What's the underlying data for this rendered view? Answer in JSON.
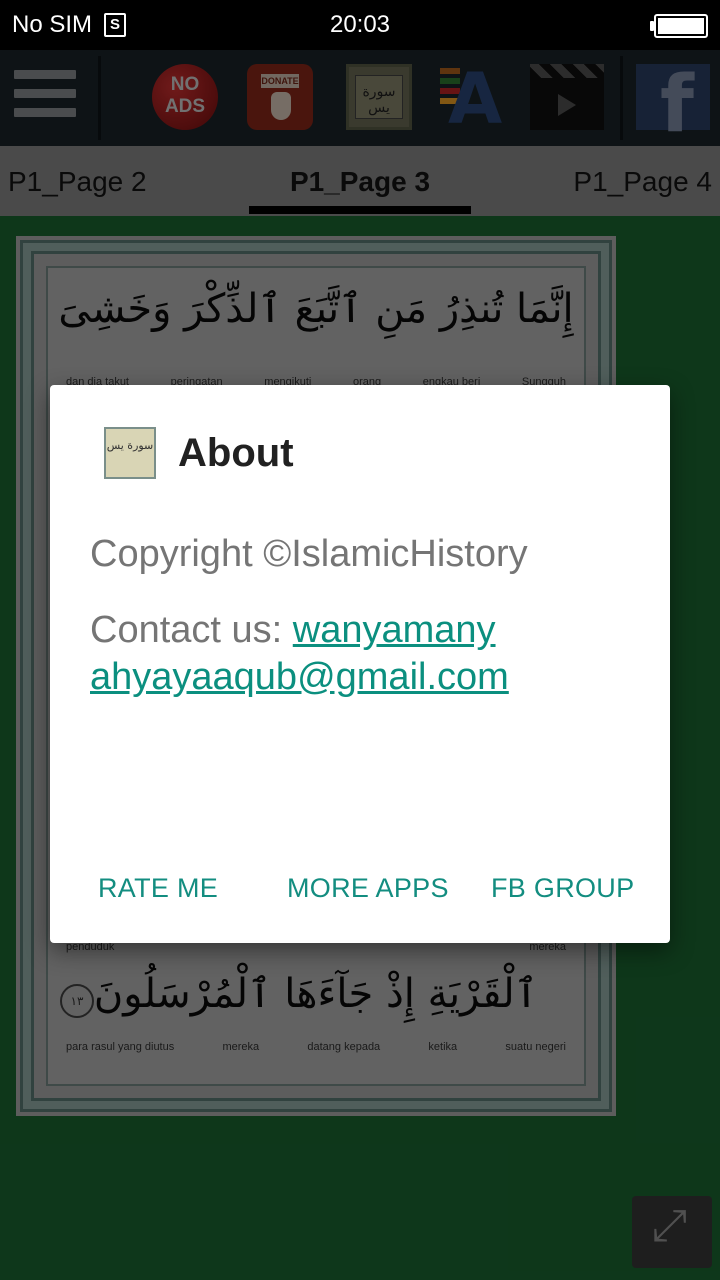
{
  "status_bar": {
    "carrier": "No SIM",
    "sim_icon_letter": "S",
    "time": "20:03"
  },
  "toolbar": {
    "menu_icon": "hamburger-icon",
    "noads_label": "NO ADS",
    "donate_label": "DONATE",
    "icons": [
      "no-ads-icon",
      "donate-icon",
      "surah-yasin-icon",
      "font-icon",
      "video-icon",
      "facebook-icon"
    ],
    "fb_letter": "f"
  },
  "tabs": {
    "left": "P1_Page 2",
    "active": "P1_Page 3",
    "right": "P1_Page 4"
  },
  "page": {
    "verse_top": "إِنَّمَا تُنذِرُ مَنِ ٱتَّبَعَ ٱلذِّكْرَ وَخَشِىَ",
    "gloss_top": [
      "dan dia takut",
      "peringatan",
      "mengikuti",
      "orang",
      "engkau beri",
      "Sungguh"
    ],
    "gloss_mid": [
      "penduduk",
      "mereka"
    ],
    "verse_bottom": "ٱلْقَرْيَةِ إِذْ جَآءَهَا ٱلْمُرْسَلُونَ",
    "gloss_bottom": [
      "para rasul yang diutus",
      "mereka",
      "datang kepada",
      "ketika",
      "suatu negeri"
    ],
    "ayah_number": "١٣"
  },
  "dialog": {
    "title": "About",
    "copyright": "Copyright ©IslamicHistory",
    "contact_prefix": "Contact us: ",
    "contact_email": "wanyamanyahyayaaqub@gmail.com",
    "buttons": {
      "rate": "RATE ME",
      "more": "MORE APPS",
      "fb_group": "FB GROUP"
    }
  },
  "fullscreen_icon": "expand-icon",
  "colors": {
    "accent": "#138d80",
    "page_bg": "#1b6a33",
    "toolbar": "#1c262b"
  }
}
